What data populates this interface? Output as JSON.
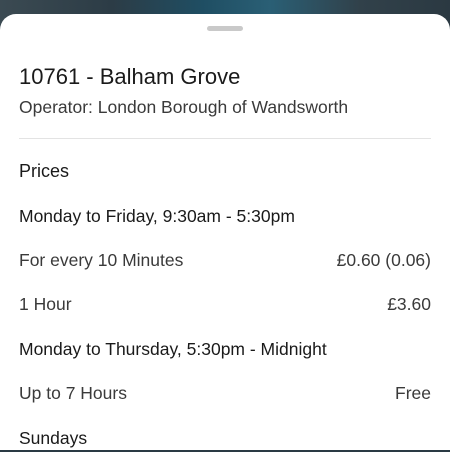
{
  "location": {
    "title": "10761 - Balham Grove",
    "operator": "Operator: London Borough of Wandsworth"
  },
  "prices": {
    "heading": "Prices",
    "rows": [
      {
        "type": "period",
        "label": "Monday to Friday, 9:30am - 5:30pm",
        "value": ""
      },
      {
        "type": "rate",
        "label": "For every 10 Minutes",
        "value": "£0.60 (0.06)"
      },
      {
        "type": "rate",
        "label": "1 Hour",
        "value": "£3.60"
      },
      {
        "type": "period",
        "label": "Monday to Thursday, 5:30pm - Midnight",
        "value": ""
      },
      {
        "type": "rate",
        "label": "Up to 7 Hours",
        "value": "Free"
      },
      {
        "type": "period",
        "label": "Sundays",
        "value": ""
      }
    ]
  }
}
